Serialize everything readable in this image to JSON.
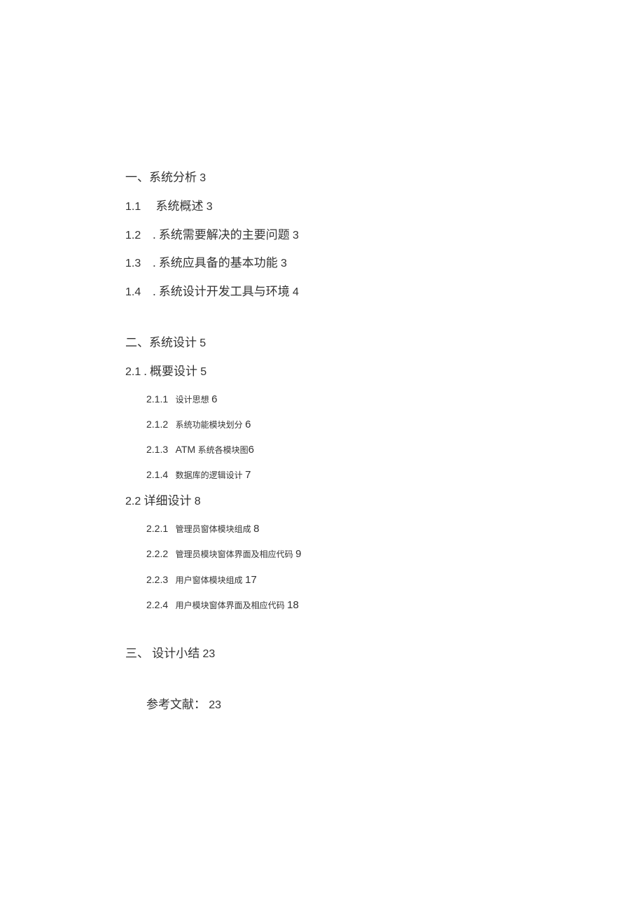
{
  "toc": {
    "section1": {
      "heading": "一、系统分析",
      "heading_page": "3",
      "items": [
        {
          "num": "1.1",
          "gap": " ",
          "text": "系统概述",
          "page": "3"
        },
        {
          "num": "1.2",
          "gap": " .",
          "text": " 系统需要解决的主要问题",
          "page": "3"
        },
        {
          "num": "1.3",
          "gap": " .",
          "text": " 系统应具备的基本功能",
          "page": "3"
        },
        {
          "num": "1.4",
          "gap": " . ",
          "text": "系统设计开发工具与环境",
          "page": "4"
        }
      ]
    },
    "section2": {
      "heading": "二、系统设计",
      "heading_page": "5",
      "sub1": {
        "num": "2.1",
        "text": " . 概要设计",
        "page": "5",
        "items": [
          {
            "num": "2.1.1",
            "text": "设计思想",
            "page": "6"
          },
          {
            "num": "2.1.2",
            "text": "系统功能模块划分",
            "page": "6"
          },
          {
            "num": "2.1.3",
            "text": "ATM 系统各模块图",
            "page": "6",
            "special": true
          },
          {
            "num": "2.1.4",
            "text": "数据库的逻辑设计",
            "page": "7"
          }
        ]
      },
      "sub2": {
        "num": "2.2",
        "text": " 详细设计",
        "page": "8",
        "items": [
          {
            "num": "2.2.1",
            "text": "管理员窗体模块组成",
            "page": "8"
          },
          {
            "num": "2.2.2",
            "text": "管理员模块窗体界面及相应代码",
            "page": "9"
          },
          {
            "num": "2.2.3",
            "text": "用户窗体模块组成",
            "page": "17"
          },
          {
            "num": "2.2.4",
            "text": "用户模块窗体界面及相应代码",
            "page": "18"
          }
        ]
      }
    },
    "section3": {
      "heading": "三、 设计小结",
      "heading_page": "23"
    },
    "references": {
      "text": "参考文献：",
      "page": "23"
    }
  }
}
